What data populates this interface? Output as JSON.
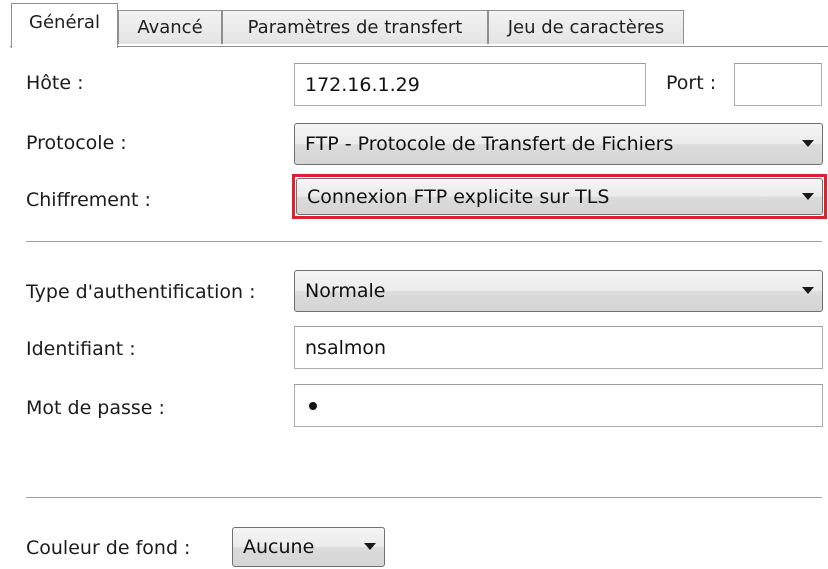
{
  "tabs": [
    {
      "label": "Général",
      "active": true
    },
    {
      "label": "Avancé",
      "active": false
    },
    {
      "label": "Paramètres de transfert",
      "active": false
    },
    {
      "label": "Jeu de caractères",
      "active": false
    }
  ],
  "server": {
    "host_label": "Hôte :",
    "host_value": "172.16.1.29",
    "port_label": "Port :",
    "port_value": "",
    "protocol_label": "Protocole :",
    "protocol_value": "FTP - Protocole de Transfert de Fichiers",
    "encryption_label": "Chiffrement :",
    "encryption_value": "Connexion FTP explicite sur TLS"
  },
  "auth": {
    "type_label": "Type d'authentification :",
    "type_value": "Normale",
    "user_label": "Identifiant :",
    "user_value": "nsalmon",
    "password_label": "Mot de passe :",
    "password_masked_length": 1
  },
  "appearance": {
    "background_label": "Couleur de fond :",
    "background_value": "Aucune"
  },
  "colors": {
    "highlight": "#e0202e",
    "border": "#abadb3"
  },
  "icons": {
    "dropdown": "chevron-down-icon"
  }
}
